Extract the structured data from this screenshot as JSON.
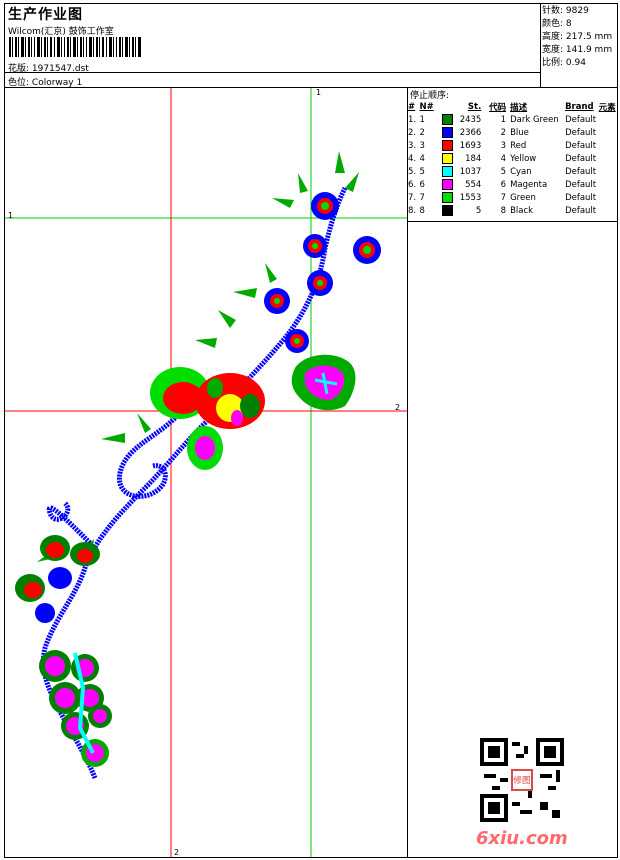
{
  "header": {
    "title": "生产作业图",
    "subtitle": "Wilcom(汇京) 鼓饰工作室",
    "design_label": "花版:",
    "design_value": "1971547.dst",
    "colorway_label": "色位:",
    "colorway_value": "Colorway 1"
  },
  "stats": {
    "stitches_label": "针数:",
    "stitches_value": "9829",
    "colors_label": "颜色:",
    "colors_value": "8",
    "height_label": "高度:",
    "height_value": "217.5 mm",
    "width_label": "宽度:",
    "width_value": "141.9 mm",
    "scale_label": "比例:",
    "scale_value": "0.94"
  },
  "sequence": {
    "title": "停止顺序:",
    "headers": {
      "hash": "#",
      "n": "N#",
      "st": "St.",
      "code": "代码",
      "desc": "描述",
      "brand": "Brand",
      "element": "元素"
    },
    "rows": [
      {
        "idx": "1.",
        "n": "1",
        "color": "#008000",
        "st": "2435",
        "code": "1",
        "desc": "Dark Green",
        "brand": "Default"
      },
      {
        "idx": "2.",
        "n": "2",
        "color": "#0000ff",
        "st": "2366",
        "code": "2",
        "desc": "Blue",
        "brand": "Default"
      },
      {
        "idx": "3.",
        "n": "3",
        "color": "#ff0000",
        "st": "1693",
        "code": "3",
        "desc": "Red",
        "brand": "Default"
      },
      {
        "idx": "4.",
        "n": "4",
        "color": "#ffff00",
        "st": "184",
        "code": "4",
        "desc": "Yellow",
        "brand": "Default"
      },
      {
        "idx": "5.",
        "n": "5",
        "color": "#00ffff",
        "st": "1037",
        "code": "5",
        "desc": "Cyan",
        "brand": "Default"
      },
      {
        "idx": "6.",
        "n": "6",
        "color": "#ff00ff",
        "st": "554",
        "code": "6",
        "desc": "Magenta",
        "brand": "Default"
      },
      {
        "idx": "7.",
        "n": "7",
        "color": "#00dd00",
        "st": "1553",
        "code": "7",
        "desc": "Green",
        "brand": "Default"
      },
      {
        "idx": "8.",
        "n": "8",
        "color": "#000000",
        "st": "5",
        "code": "8",
        "desc": "Black",
        "brand": "Default"
      }
    ]
  },
  "guides": {
    "g1_top": "1",
    "g1_left": "1",
    "g2_right": "2",
    "g2_bottom": "2"
  },
  "watermark": {
    "brand": "6xiu.com",
    "seal": "修图"
  },
  "colors": {
    "guide_green": "#00cc00",
    "guide_red": "#ff0000",
    "brand": "#ff6a6a"
  }
}
